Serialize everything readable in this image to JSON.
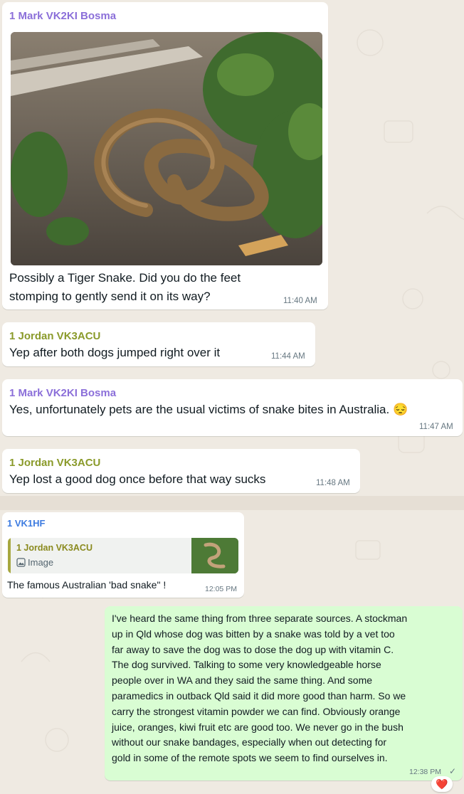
{
  "messages": [
    {
      "sender": "1 Mark VK2KI Bosma",
      "sender_color": "#8b6fd9",
      "has_image": true,
      "text_lines": [
        "Possibly a Tiger Snake.  Did you do the feet",
        "stomping to gently send it on its way?"
      ],
      "time": "11:40 AM"
    },
    {
      "sender": "1 Jordan VK3ACU",
      "sender_color": "#8a9a2a",
      "text": "Yep after both dogs jumped right over it",
      "time": "11:44 AM"
    },
    {
      "sender": "1 Mark VK2KI Bosma",
      "sender_color": "#8b6fd9",
      "text": "Yes, unfortunately pets are the usual victims of snake bites in Australia. 😔",
      "time": "11:47 AM"
    },
    {
      "sender": "1 Jordan VK3ACU",
      "sender_color": "#8a9a2a",
      "text": "Yep lost a good dog once before that way sucks",
      "time": "11:48 AM"
    },
    {
      "sender": "1 VK1HF",
      "sender_color": "#3d7be0",
      "quote": {
        "sender": "1 Jordan VK3ACU",
        "type": "Image"
      },
      "text": "The famous Australian 'bad snake\" !",
      "time": "12:05 PM"
    },
    {
      "outgoing": true,
      "text_lines": [
        "I've heard the same thing from three separate sources. A stockman",
        "up in Qld whose dog was bitten by a snake was told by a vet too",
        "far away to save the dog was to dose the dog up with vitamin C.",
        "The dog survived. Talking to some very knowledgeable horse",
        "people over in WA and they said the same thing. And some",
        "paramedics in outback Qld said it did more good than harm. So we",
        "carry the strongest vitamin powder we  can find. Obviously orange",
        "juice, oranges, kiwi fruit etc are good too. We never go in the bush",
        "without our snake bandages, especially when out detecting for",
        "gold in some of the remote spots we seem to find ourselves in."
      ],
      "time": "12:38 PM",
      "status": "✓",
      "reaction": "❤️"
    }
  ],
  "icons": {
    "quote_type_icon": "image-icon",
    "read_status": "single-check-icon"
  }
}
